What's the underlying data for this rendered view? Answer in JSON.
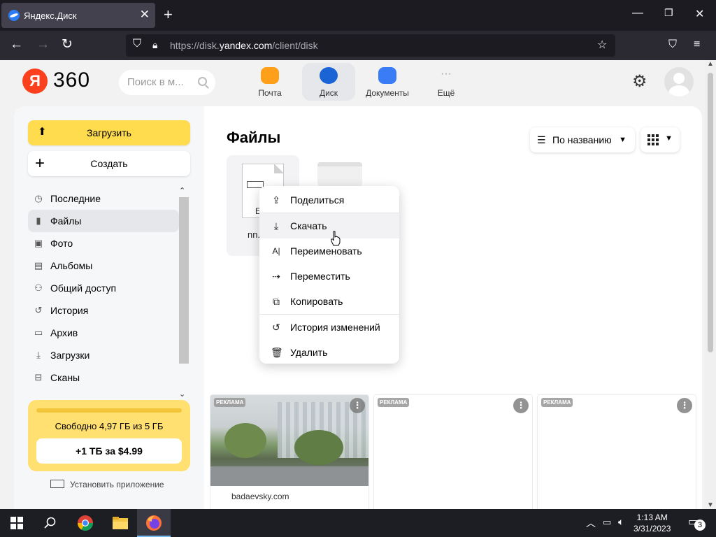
{
  "browser": {
    "tab_title": "Яндекс.Диск",
    "tab_close": "✕",
    "new_tab": "+",
    "url_prefix": "https://disk.",
    "url_domain": "yandex.com",
    "url_path": "/client/disk"
  },
  "header": {
    "logo_ya": "Я",
    "logo_num": "360",
    "search_placeholder": "Поиск в м...",
    "services": [
      {
        "label": "Почта",
        "color": "#ff9f1a"
      },
      {
        "label": "Диск",
        "color": "#1a64d6"
      },
      {
        "label": "Документы",
        "color": "#3a7bf6"
      },
      {
        "label": "Ещё",
        "color": "#9ba0a8"
      }
    ],
    "more_dots": "···"
  },
  "sidebar": {
    "upload_label": "Загрузить",
    "create_label": "Создать",
    "items": [
      {
        "label": "Последние",
        "icon": "clock-icon",
        "glyph": "◷"
      },
      {
        "label": "Файлы",
        "icon": "file-icon",
        "glyph": "▮"
      },
      {
        "label": "Фото",
        "icon": "photo-icon",
        "glyph": "▣"
      },
      {
        "label": "Альбомы",
        "icon": "albums-icon",
        "glyph": "▤"
      },
      {
        "label": "Общий доступ",
        "icon": "people-icon",
        "glyph": "⚇"
      },
      {
        "label": "История",
        "icon": "history-icon",
        "glyph": "↺"
      },
      {
        "label": "Архив",
        "icon": "archive-icon",
        "glyph": "▭"
      },
      {
        "label": "Загрузки",
        "icon": "download-icon",
        "glyph": "⤓"
      },
      {
        "label": "Сканы",
        "icon": "scan-icon",
        "glyph": "⊟"
      }
    ],
    "storage_free": "Свободно 4,97 ГБ из 5 ГБ",
    "storage_buy": "+1 ТБ за $4.99",
    "install_app": "Установить приложение"
  },
  "content": {
    "title": "Файлы",
    "sort_label": "По названию",
    "file_name": "nn.",
    "file_ext": "E"
  },
  "context_menu": {
    "items": [
      {
        "label": "Поделиться",
        "icon": "share-icon",
        "glyph": "⇪"
      },
      {
        "label": "Скачать",
        "icon": "download-icon",
        "glyph": "⤓"
      },
      {
        "label": "Переименовать",
        "icon": "rename-icon",
        "glyph": "A|"
      },
      {
        "label": "Переместить",
        "icon": "move-icon",
        "glyph": "⇢"
      },
      {
        "label": "Копировать",
        "icon": "copy-icon",
        "glyph": "⧉"
      },
      {
        "label": "История изменений",
        "icon": "history-icon",
        "glyph": "↺"
      },
      {
        "label": "Удалить",
        "icon": "trash-icon",
        "glyph": "🗑"
      }
    ]
  },
  "ads": [
    {
      "badge": "РЕКЛАМА",
      "source": "badaevsky.com"
    },
    {
      "badge": "РЕКЛАМА",
      "source": ""
    },
    {
      "badge": "РЕКЛАМА",
      "source": ""
    }
  ],
  "taskbar": {
    "time": "1:13 AM",
    "date": "3/31/2023",
    "notifications": "3"
  }
}
